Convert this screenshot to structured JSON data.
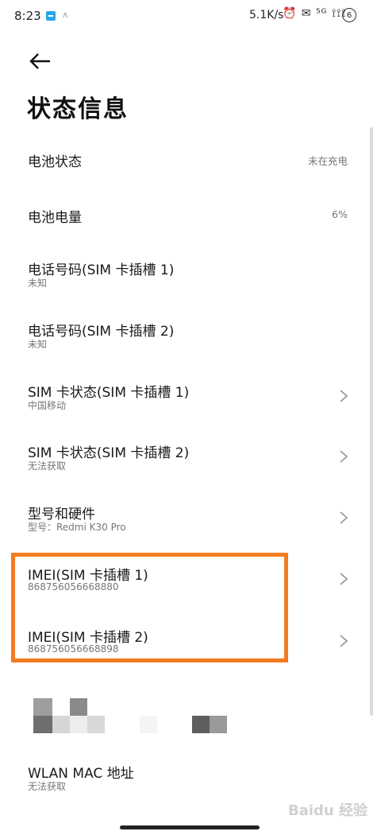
{
  "status_bar": {
    "time": "8:23",
    "small_indicator": "ʌ",
    "net_speed": "5.1K/s",
    "icons": "⏰ ✉ ⁵ᴳ ⟟⟟⟟",
    "battery": "6"
  },
  "page": {
    "title": "状态信息"
  },
  "rows": [
    {
      "label": "电池状态",
      "value": "未在充电"
    },
    {
      "label": "电池电量",
      "value": "6%"
    },
    {
      "label": "电话号码(SIM 卡插槽 1)",
      "sub": "未知"
    },
    {
      "label": "电话号码(SIM 卡插槽 2)",
      "sub": "未知"
    },
    {
      "label": "SIM 卡状态(SIM 卡插槽 1)",
      "sub": "中国移动"
    },
    {
      "label": "SIM 卡状态(SIM 卡插槽 2)",
      "sub": "无法获取"
    },
    {
      "label": "型号和硬件",
      "sub": "型号：Redmi K30 Pro"
    },
    {
      "label": "IMEI(SIM 卡插槽 1)",
      "sub": "868756056668880"
    },
    {
      "label": "IMEI(SIM 卡插槽 2)",
      "sub": "868756056668898"
    },
    {
      "label": "WLAN MAC 地址",
      "sub": "无法获取"
    }
  ],
  "watermark": "Baidu 经验",
  "colors": {
    "highlight": "#f47b20",
    "status_app_icon": "#2aa6e8"
  }
}
